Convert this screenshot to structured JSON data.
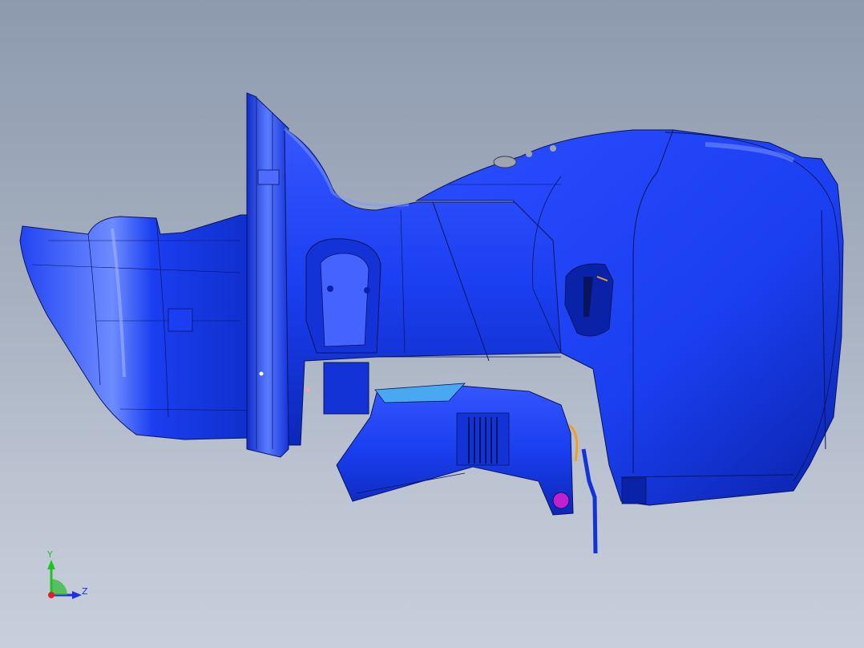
{
  "viewport": {
    "background_top": "#8d9aae",
    "background_bottom": "#c8cfdc"
  },
  "model": {
    "main_color": "#1a3ff0",
    "shade_color": "#0a22a8",
    "highlight_color": "#7f9bff",
    "edge_color": "#08155e",
    "accent_orange": "#f0a020",
    "accent_magenta": "#c020d0",
    "accent_lightblue": "#4aa8f0"
  },
  "triad": {
    "y_axis_label": "Y",
    "z_axis_label": "Z",
    "y_color": "#1fc41f",
    "z_color": "#2030e0",
    "x_color": "#e02020"
  }
}
